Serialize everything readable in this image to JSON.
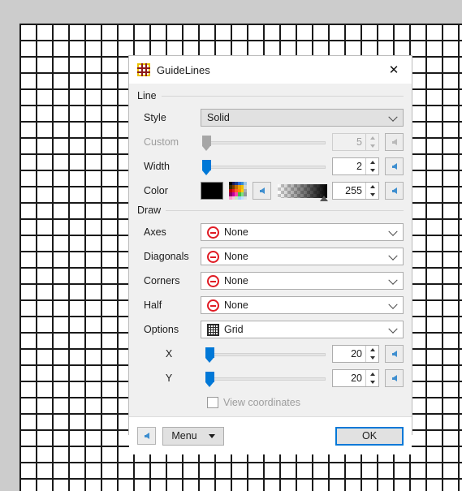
{
  "canvas": {
    "description": "grid-background"
  },
  "dialog": {
    "title": "GuideLines",
    "icon": "grid-frame-icon",
    "close_label": "✕",
    "groups": {
      "line": {
        "title": "Line",
        "rows": [
          {
            "label": "Style",
            "type": "combo",
            "value": "Solid"
          },
          {
            "label": "Custom",
            "type": "slider",
            "value": "5",
            "disabled": true,
            "handle_pct": 2
          },
          {
            "label": "Width",
            "type": "slider",
            "value": "2",
            "disabled": false,
            "handle_pct": 2
          },
          {
            "label": "Color",
            "type": "color",
            "value": "255",
            "swatch": "#000000"
          }
        ]
      },
      "draw": {
        "title": "Draw",
        "rows": [
          {
            "label": "Axes",
            "type": "combo-icon",
            "value": "None",
            "icon": "none-circle-icon"
          },
          {
            "label": "Diagonals",
            "type": "combo-icon",
            "value": "None",
            "icon": "none-circle-icon"
          },
          {
            "label": "Corners",
            "type": "combo-icon",
            "value": "None",
            "icon": "none-circle-icon"
          },
          {
            "label": "Half",
            "type": "combo-icon",
            "value": "None",
            "icon": "none-circle-icon"
          },
          {
            "label": "Options",
            "type": "combo-icon",
            "value": "Grid",
            "icon": "grid-icon"
          },
          {
            "label": "X",
            "type": "slider",
            "value": "20",
            "handle_pct": 3
          },
          {
            "label": "Y",
            "type": "slider",
            "value": "20",
            "handle_pct": 3
          }
        ],
        "checkbox": {
          "label": "View coordinates",
          "checked": false
        }
      }
    },
    "footer": {
      "reset_icon": "reset-arrow-icon",
      "menu_label": "Menu",
      "ok_label": "OK"
    }
  },
  "colors": {
    "accent": "#0078d7",
    "none_red": "#e01b24",
    "title_icon_border": "#e8c000",
    "title_icon_lines": "#8b1a1a",
    "dialog_bg": "#f0f0f0",
    "desktop_bg": "#cccccc",
    "grid_line": "#1a1a1a"
  },
  "palette_swatches": [
    "#000000",
    "#1b1b5a",
    "#1b3a8c",
    "#2a6bd4",
    "#3f8fd0",
    "#9bc6e8",
    "#3a2a00",
    "#7a3a00",
    "#c46a00",
    "#e8a000",
    "#f0c000",
    "#cfd4d8",
    "#c00000",
    "#e01b24",
    "#ff5a2a",
    "#ff8a00",
    "#ffd000",
    "#a8aeb4",
    "#8a0060",
    "#c000a0",
    "#ff40b0",
    "#40c040",
    "#80e080",
    "#8f959b",
    "#ff9ad0",
    "#ffc0e0",
    "#c0f0c0",
    "#a0d0ff",
    "#c0e0ff",
    "#dfe3e6"
  ]
}
